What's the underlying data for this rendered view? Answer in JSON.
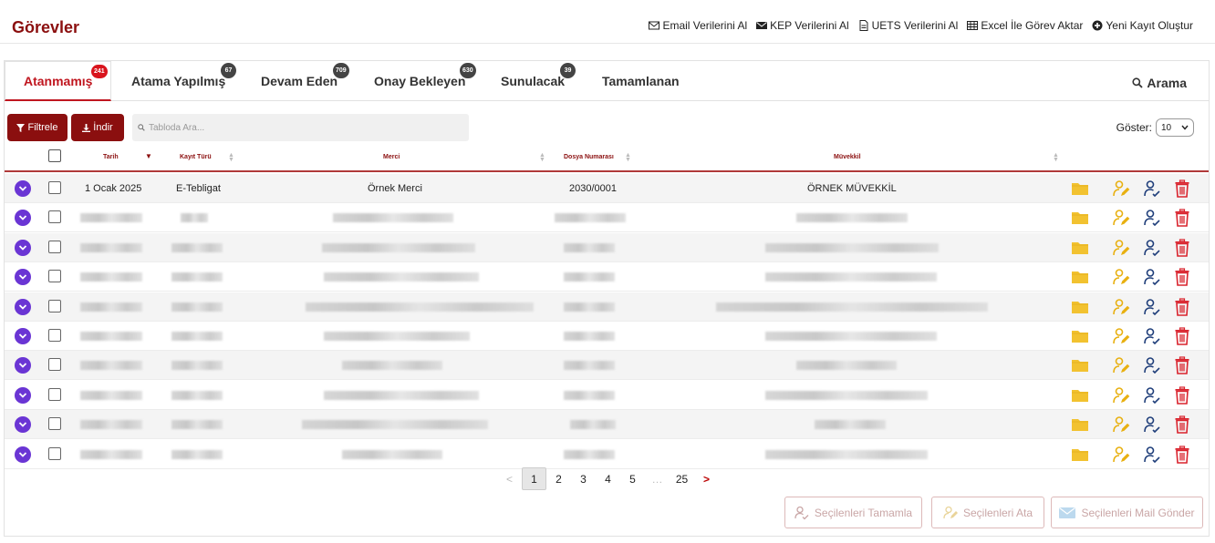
{
  "header": {
    "title": "Görevler",
    "actions": [
      {
        "label": "Email Verilerini Al",
        "icon": "envelope-outline-icon"
      },
      {
        "label": "KEP Verilerini Al",
        "icon": "envelope-solid-icon"
      },
      {
        "label": "UETS Verilerini Al",
        "icon": "document-icon"
      },
      {
        "label": "Excel İle Görev Aktar",
        "icon": "table-icon"
      },
      {
        "label": "Yeni Kayıt Oluştur",
        "icon": "plus-circle-icon"
      }
    ]
  },
  "tabs": [
    {
      "label": "Atanmamış",
      "badge": "241",
      "active": true
    },
    {
      "label": "Atama Yapılmış",
      "badge": "67"
    },
    {
      "label": "Devam Eden",
      "badge": "709"
    },
    {
      "label": "Onay Bekleyen",
      "badge": "630"
    },
    {
      "label": "Sunulacak",
      "badge": "39"
    },
    {
      "label": "Tamamlanan",
      "badge": ""
    }
  ],
  "search_tab": {
    "label": "Arama"
  },
  "toolbar": {
    "filter_label": "Filtrele",
    "download_label": "İndir",
    "search_placeholder": "Tabloda Ara...",
    "show_label": "Göster:",
    "show_value": "10"
  },
  "table": {
    "columns": [
      "Tarih",
      "Kayıt Türü",
      "Merci",
      "Dosya Numarası",
      "Müvekkil"
    ],
    "rows": [
      {
        "tarih": "1 Ocak 2025",
        "kayit_turu": "E-Tebligat",
        "merci": "Örnek Merci",
        "dosya_no": "2030/0001",
        "muvekkil": "ÖRNEK MÜVEKKİL"
      }
    ],
    "redacted_row_count": 9
  },
  "pagination": {
    "prev": "<",
    "pages": [
      "1",
      "2",
      "3",
      "4",
      "5",
      "…",
      "25"
    ],
    "current": "1",
    "next": ">"
  },
  "bulk_actions": {
    "complete_label": "Seçilenleri Tamamla",
    "assign_label": "Seçilenleri Ata",
    "mail_label": "Seçilenleri Mail Gönder"
  },
  "colors": {
    "brand": "#8b0f0f",
    "active_tab": "#c0161f",
    "expand": "#6a35d4",
    "folder": "#f2c230",
    "assign": "#e8b010",
    "user": "#1f3e7a",
    "delete": "#d9232d"
  }
}
